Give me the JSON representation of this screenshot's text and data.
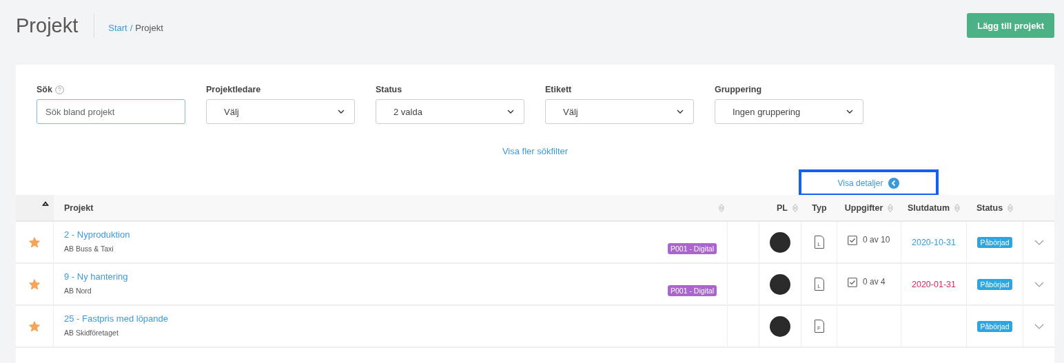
{
  "header": {
    "title": "Projekt",
    "breadcrumb": {
      "parent": "Start",
      "separator": "/",
      "current": "Projekt"
    },
    "add_button": "Lägg till projekt"
  },
  "filters": [
    {
      "kind": "search",
      "label": "Sök",
      "help": true,
      "placeholder": "Sök bland projekt"
    },
    {
      "kind": "select",
      "label": "Projektledare",
      "value": "Välj"
    },
    {
      "kind": "select",
      "label": "Status",
      "value": "2 valda"
    },
    {
      "kind": "select",
      "label": "Etikett",
      "value": "Välj"
    },
    {
      "kind": "select",
      "label": "Gruppering",
      "value": "Ingen gruppering"
    }
  ],
  "more_filters": "Visa fler sökfilter",
  "details_button": {
    "label": "Visa detaljer",
    "highlighted": true
  },
  "table": {
    "columns": [
      {
        "sorted": true
      },
      {
        "label": "Projekt",
        "sortable": true
      },
      {
        "label": "PL",
        "sortable": true
      },
      {
        "label": "Typ"
      },
      {
        "label": "Uppgifter",
        "sortable": true
      },
      {
        "label": "Slutdatum",
        "sortable": true
      },
      {
        "label": "Status",
        "sortable": true
      }
    ],
    "rows": [
      {
        "starred": true,
        "title": "2 - Nyproduktion",
        "customer": "AB Buss & Taxi",
        "tag": "P001 - Digital",
        "type_letter": "L",
        "tasks": "0 av 10",
        "end_date": "2020-10-31",
        "overdue": false,
        "status": "Påbörjad"
      },
      {
        "starred": true,
        "title": "9 - Ny hantering",
        "customer": "AB Nord",
        "tag": "P001 - Digital",
        "type_letter": "L",
        "tasks": "0 av 4",
        "end_date": "2020-01-31",
        "overdue": true,
        "status": "Påbörjad"
      },
      {
        "starred": true,
        "title": "25 - Fastpris med löpande",
        "customer": "AB Skidföretaget",
        "type_letter": "F",
        "status": "Påbörjad"
      }
    ]
  }
}
